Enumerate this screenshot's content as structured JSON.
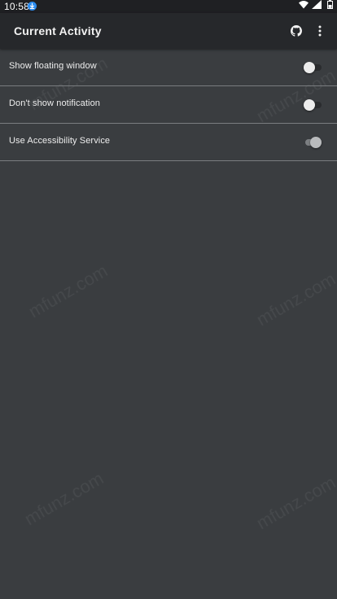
{
  "status_bar": {
    "time": "10:58",
    "icons": [
      "download-icon",
      "wifi-icon",
      "signal-icon",
      "battery-icon"
    ]
  },
  "app_bar": {
    "title": "Current Activity",
    "actions": [
      "github-icon",
      "more-vert-icon"
    ]
  },
  "settings": [
    {
      "label": "Show floating window",
      "checked": false,
      "enabled": true
    },
    {
      "label": "Don't show notification",
      "checked": false,
      "enabled": true
    },
    {
      "label": "Use Accessibility Service",
      "checked": true,
      "enabled": false
    }
  ],
  "watermark": "mfunz.com",
  "colors": {
    "background": "#3a3d40",
    "app_bar": "#26282b",
    "status_bar": "#1f2023",
    "divider": "#7a7d80",
    "accent_download": "#2b8cf0"
  }
}
